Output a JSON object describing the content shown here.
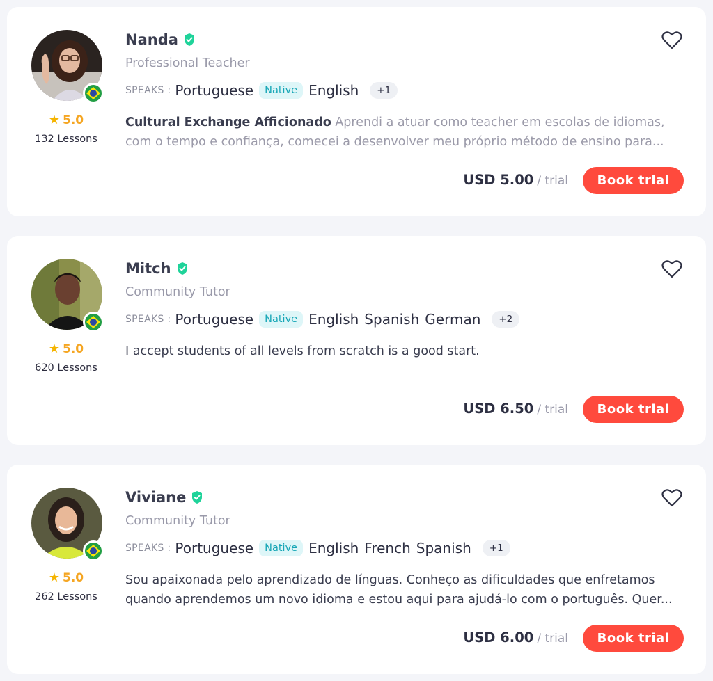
{
  "tutors": [
    {
      "name": "Nanda",
      "title": "Professional Teacher",
      "rating": "5.0",
      "lessons": "132 Lessons",
      "speaks_label": "SPEAKS :",
      "native_language": "Portuguese",
      "native_badge": "Native",
      "other_languages": [
        "English"
      ],
      "more_count": "+1",
      "headline": "Cultural Exchange Afficionado",
      "description_line1": " Aprendi a atuar como teacher em escolas de idiomas,",
      "description_line2": "com o tempo e confiança, comecei a desenvolver meu próprio método de ensino para...",
      "price": "USD 5.00",
      "price_unit": "/ trial",
      "book_label": "Book trial",
      "flag_icon": "brazil-flag-icon"
    },
    {
      "name": "Mitch",
      "title": "Community Tutor",
      "rating": "5.0",
      "lessons": "620 Lessons",
      "speaks_label": "SPEAKS :",
      "native_language": "Portuguese",
      "native_badge": "Native",
      "other_languages": [
        "English",
        "Spanish",
        "German"
      ],
      "more_count": "+2",
      "headline": "",
      "description_line1": "I accept students of all levels from scratch is a good start.",
      "description_line2": "",
      "price": "USD 6.50",
      "price_unit": "/ trial",
      "book_label": "Book trial",
      "flag_icon": "brazil-flag-icon"
    },
    {
      "name": "Viviane",
      "title": "Community Tutor",
      "rating": "5.0",
      "lessons": "262 Lessons",
      "speaks_label": "SPEAKS :",
      "native_language": "Portuguese",
      "native_badge": "Native",
      "other_languages": [
        "English",
        "French",
        "Spanish"
      ],
      "more_count": "+1",
      "headline": "",
      "description_line1": "Sou apaixonada pelo aprendizado de línguas. Conheço as dificuldades que enfretamos",
      "description_line2": "quando aprendemos um novo idioma e estou aqui para ajudá-lo com o português. Quer...",
      "price": "USD 6.00",
      "price_unit": "/ trial",
      "book_label": "Book trial",
      "flag_icon": "brazil-flag-icon"
    }
  ],
  "colors": {
    "accent_button": "#ff4a3d",
    "verified": "#1fd39a",
    "native_badge_text": "#16a6b6",
    "native_badge_bg": "#def6f8",
    "star": "#f5b400",
    "page_bg": "#f4f5f9"
  }
}
